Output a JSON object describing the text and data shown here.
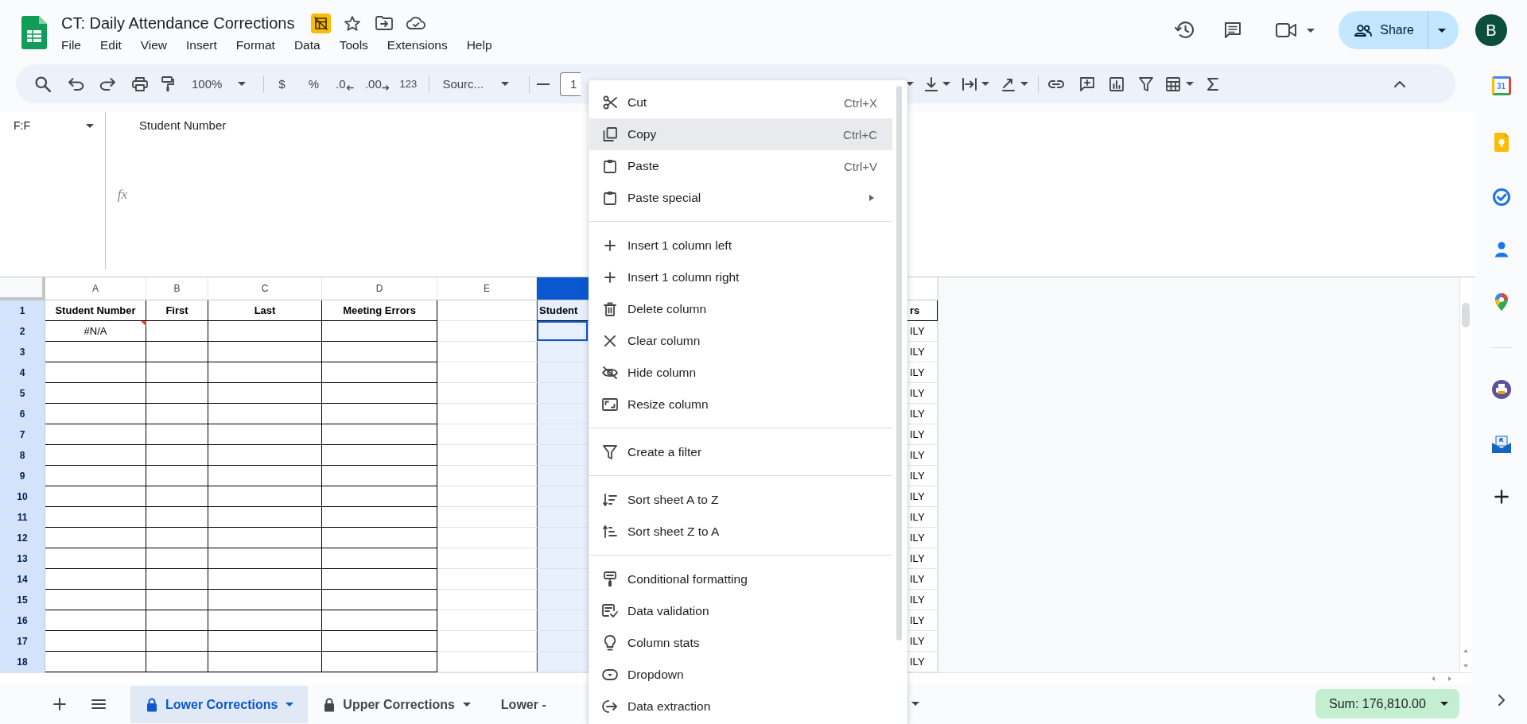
{
  "document": {
    "title": "CT: Daily Attendance Corrections",
    "menus": [
      "File",
      "Edit",
      "View",
      "Insert",
      "Format",
      "Data",
      "Tools",
      "Extensions",
      "Help"
    ]
  },
  "header": {
    "share": "Share",
    "avatar": "B"
  },
  "toolbar": {
    "zoom": "100%",
    "currency": "$",
    "percent": "%",
    "decrease_decimal": ".0",
    "increase_decimal": ".00",
    "number_format": "123",
    "font": "Sourc...",
    "font_size": "1"
  },
  "formula_bar": {
    "name_box": "F:F",
    "fx": "fx",
    "content": "Student Number"
  },
  "grid": {
    "columns": [
      {
        "label": "A",
        "selected": false
      },
      {
        "label": "B",
        "selected": false
      },
      {
        "label": "C",
        "selected": false
      },
      {
        "label": "D",
        "selected": false
      },
      {
        "label": "E",
        "selected": false
      },
      {
        "selected": true
      }
    ],
    "rows": [
      {
        "label": "1",
        "kind": "header",
        "a": "Student Number",
        "b": "First",
        "c": "Last",
        "d": "Meeting Errors",
        "f": "Student",
        "column_7": "rs",
        "a_error": false,
        "f_active": false
      },
      {
        "label": "2",
        "kind": "data",
        "a": "#N/A",
        "column_7": "ILY",
        "a_error": true,
        "f_active": true
      },
      {
        "label": "3",
        "kind": "data",
        "column_7": "ILY",
        "a_error": false,
        "f_active": false
      },
      {
        "label": "4",
        "kind": "data",
        "column_7": "ILY",
        "a_error": false,
        "f_active": false
      },
      {
        "label": "5",
        "kind": "data",
        "column_7": "ILY",
        "a_error": false,
        "f_active": false
      },
      {
        "label": "6",
        "kind": "data",
        "column_7": "ILY",
        "a_error": false,
        "f_active": false
      },
      {
        "label": "7",
        "kind": "data",
        "column_7": "ILY",
        "a_error": false,
        "f_active": false
      },
      {
        "label": "8",
        "kind": "data",
        "column_7": "ILY",
        "a_error": false,
        "f_active": false
      },
      {
        "label": "9",
        "kind": "data",
        "column_7": "ILY",
        "a_error": false,
        "f_active": false
      },
      {
        "label": "10",
        "kind": "data",
        "column_7": "ILY",
        "a_error": false,
        "f_active": false
      },
      {
        "label": "11",
        "kind": "data",
        "column_7": "ILY",
        "a_error": false,
        "f_active": false
      },
      {
        "label": "12",
        "kind": "data",
        "column_7": "ILY",
        "a_error": false,
        "f_active": false
      },
      {
        "label": "13",
        "kind": "data",
        "column_7": "ILY",
        "a_error": false,
        "f_active": false
      },
      {
        "label": "14",
        "kind": "data",
        "column_7": "ILY",
        "a_error": false,
        "f_active": false
      },
      {
        "label": "15",
        "kind": "data",
        "column_7": "ILY",
        "a_error": false,
        "f_active": false
      },
      {
        "label": "16",
        "kind": "data",
        "column_7": "ILY",
        "a_error": false,
        "f_active": false
      },
      {
        "label": "17",
        "kind": "data",
        "column_7": "ILY",
        "a_error": false,
        "f_active": false
      },
      {
        "label": "18",
        "kind": "data",
        "column_7": "ILY",
        "a_error": false,
        "f_active": false
      }
    ]
  },
  "context_menu": {
    "sections": [
      {
        "items": [
          {
            "label": "Cut",
            "shortcut": "Ctrl+X",
            "kind": "action",
            "selected": false
          },
          {
            "label": "Copy",
            "shortcut": "Ctrl+C",
            "kind": "action",
            "selected": true
          },
          {
            "label": "Paste",
            "shortcut": "Ctrl+V",
            "kind": "action",
            "selected": false
          },
          {
            "label": "Paste special",
            "kind": "submenu",
            "selected": false
          }
        ]
      },
      {
        "items": [
          {
            "label": "Insert 1 column left",
            "kind": "action",
            "selected": false
          },
          {
            "label": "Insert 1 column right",
            "kind": "action",
            "selected": false
          },
          {
            "label": "Delete column",
            "kind": "action",
            "selected": false
          },
          {
            "label": "Clear column",
            "kind": "action",
            "selected": false
          },
          {
            "label": "Hide column",
            "kind": "action",
            "selected": false
          },
          {
            "label": "Resize column",
            "kind": "action",
            "selected": false
          }
        ]
      },
      {
        "items": [
          {
            "label": "Create a filter",
            "kind": "action",
            "selected": false
          }
        ]
      },
      {
        "items": [
          {
            "label": "Sort sheet A to Z",
            "kind": "action",
            "selected": false
          },
          {
            "label": "Sort sheet Z to A",
            "kind": "action",
            "selected": false
          }
        ]
      },
      {
        "items": [
          {
            "label": "Conditional formatting",
            "kind": "action",
            "selected": false
          },
          {
            "label": "Data validation",
            "kind": "action",
            "selected": false
          },
          {
            "label": "Column stats",
            "kind": "action",
            "selected": false
          },
          {
            "label": "Dropdown",
            "kind": "action",
            "selected": false
          },
          {
            "label": "Data extraction",
            "kind": "action",
            "selected": false
          }
        ]
      }
    ]
  },
  "sheet_tabs": [
    {
      "label": "Lower Corrections",
      "selected": true,
      "locked": true
    },
    {
      "label": "Upper Corrections",
      "selected": false,
      "locked": true
    },
    {
      "label": "Lower -",
      "selected": false,
      "locked": false
    }
  ],
  "status_bar": {
    "sum": "Sum: 176,810.00"
  },
  "side_panel": {
    "calendar_day": "31"
  }
}
